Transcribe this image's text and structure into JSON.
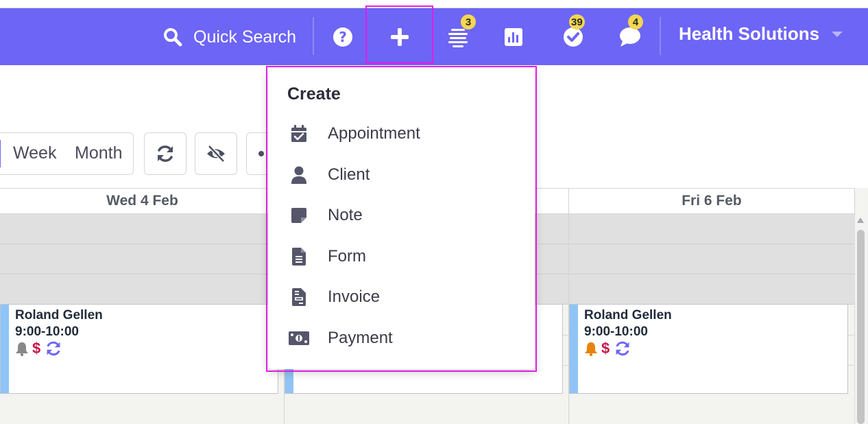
{
  "topbar": {
    "quick_search": "Quick Search",
    "help_icon": "question-circle-icon",
    "add_icon": "plus-icon",
    "notifications_count": "3",
    "reports_icon": "bar-chart-icon",
    "tasks_count": "39",
    "messages_count": "4",
    "organization": "Health Solutions"
  },
  "view_switcher": {
    "week": "Week",
    "month": "Month"
  },
  "calendar": {
    "columns": [
      {
        "label": "Wed 4 Feb"
      },
      {
        "label": ""
      },
      {
        "label": "Fri 6 Feb"
      }
    ],
    "appointments": [
      {
        "client": "Roland Gellen",
        "time": "9:00-10:00",
        "currency": "$",
        "bell_color": "#888888"
      },
      {
        "client": "Roland Gellen",
        "time": "9:00-10:00",
        "currency": "$",
        "bell_color": "#e8840a"
      }
    ]
  },
  "create_menu": {
    "title": "Create",
    "items": [
      {
        "label": "Appointment",
        "icon": "calendar-check-icon"
      },
      {
        "label": "Client",
        "icon": "user-icon"
      },
      {
        "label": "Note",
        "icon": "sticky-note-icon"
      },
      {
        "label": "Form",
        "icon": "file-text-icon"
      },
      {
        "label": "Invoice",
        "icon": "invoice-icon"
      },
      {
        "label": "Payment",
        "icon": "money-bill-icon"
      }
    ]
  },
  "colors": {
    "topbar": "#6d65f5",
    "badge": "#f4d64f",
    "highlight": "#e31ee6",
    "appointment_stripe": "#8fc4f7"
  }
}
